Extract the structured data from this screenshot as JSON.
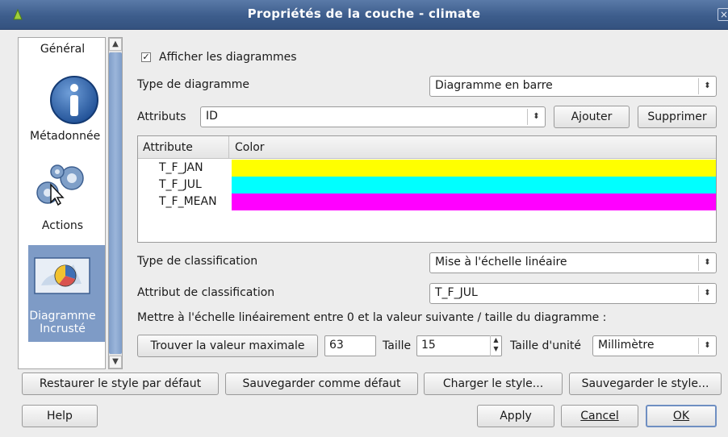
{
  "window": {
    "title": "Propriétés de la couche - climate"
  },
  "sidebar": {
    "items": [
      {
        "label": "Général",
        "icon": "info-icon"
      },
      {
        "label": "Métadonnées",
        "icon": "gears-icon"
      },
      {
        "label": "Actions",
        "icon": "gears-icon"
      },
      {
        "label": "Diagramme Incrusté",
        "icon": "diagram-map-icon",
        "selected": true
      }
    ],
    "labels": {
      "general": "Général",
      "metadata": "Métadonnée",
      "actions": "Actions",
      "diagram": "Diagramme Incrusté"
    }
  },
  "diagram": {
    "show_checkbox": {
      "label": "Afficher les diagrammes",
      "checked": true
    },
    "type_label": "Type de diagramme",
    "type_value": "Diagramme en barre",
    "attributes_label": "Attributs",
    "attributes_value": "ID",
    "add_button": "Ajouter",
    "remove_button": "Supprimer",
    "table": {
      "headers": [
        "Attribute",
        "Color"
      ],
      "rows": [
        {
          "attribute": "T_F_JAN",
          "color": "#ffff00"
        },
        {
          "attribute": "T_F_JUL",
          "color": "#00ffff"
        },
        {
          "attribute": "T_F_MEAN",
          "color": "#ff00ff"
        }
      ]
    },
    "classification_type_label": "Type de classification",
    "classification_type_value": "Mise à l'échelle linéaire",
    "classification_attr_label": "Attribut de classification",
    "classification_attr_value": "T_F_JUL",
    "scale_text": "Mettre à l'échelle linéairement entre 0 et la valeur suivante / taille du diagramme :",
    "find_max_button": "Trouver la valeur maximale",
    "max_value": "63",
    "size_label": "Taille",
    "size_value": "15",
    "unit_label": "Taille d'unité",
    "unit_value": "Millimètre"
  },
  "footer": {
    "restore_default": "Restaurer le style par défaut",
    "save_default": "Sauvegarder comme défaut",
    "load_style": "Charger le style...",
    "save_style": "Sauvegarder le style...",
    "help": "Help",
    "apply": "Apply",
    "cancel": "Cancel",
    "ok": "OK"
  }
}
